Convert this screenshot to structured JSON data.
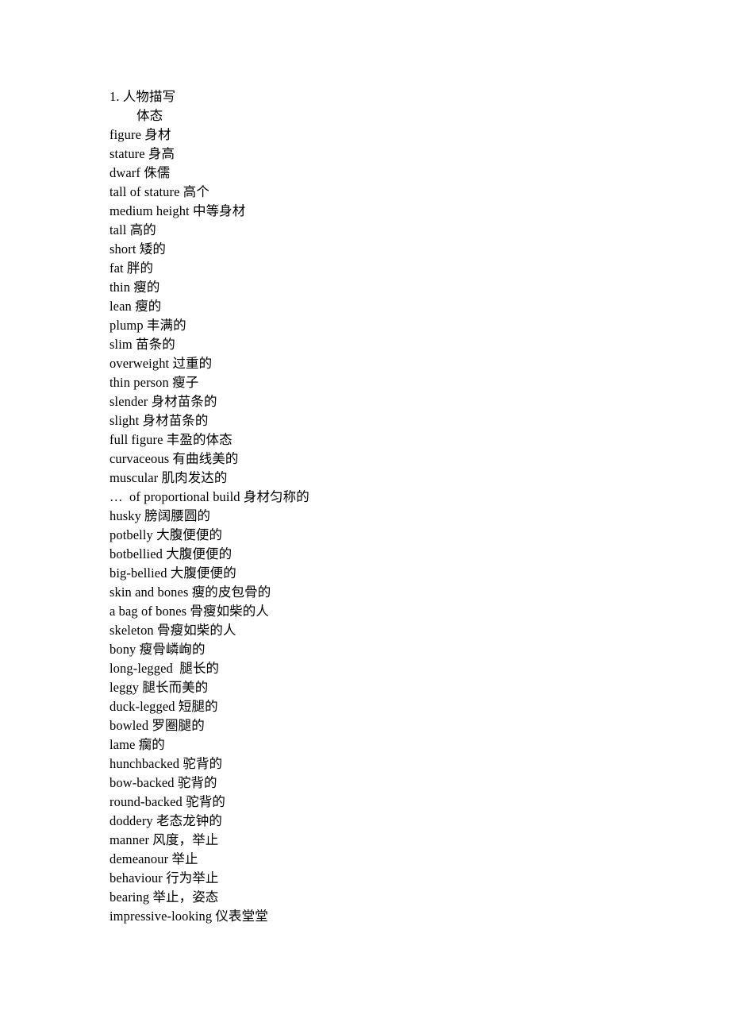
{
  "document": {
    "section_number": "1.",
    "section_title": "人物描写",
    "subsection_title": "体态",
    "heading_line": "1. 人物描写",
    "entries": [
      "figure 身材",
      "stature 身高",
      "dwarf 侏儒",
      "tall of stature 高个",
      "medium height 中等身材",
      "tall 高的",
      "short 矮的",
      "fat 胖的",
      "thin 瘦的",
      "lean 瘦的",
      "plump 丰满的",
      "slim 苗条的",
      "overweight 过重的",
      "thin person 瘦子",
      "slender 身材苗条的",
      "slight 身材苗条的",
      "full figure 丰盈的体态",
      "curvaceous 有曲线美的",
      "muscular 肌肉发达的",
      "…  of proportional build 身材匀称的",
      "husky 膀阔腰圆的",
      "potbelly 大腹便便的",
      "botbellied 大腹便便的",
      "big-bellied 大腹便便的",
      "skin and bones 瘦的皮包骨的",
      "a bag of bones 骨瘦如柴的人",
      "skeleton 骨瘦如柴的人",
      "bony 瘦骨嶙峋的",
      "long-legged  腿长的",
      "leggy 腿长而美的",
      "duck-legged 短腿的",
      "bowled 罗圈腿的",
      "lame 瘸的",
      "hunchbacked 驼背的",
      "bow-backed 驼背的",
      "round-backed 驼背的",
      "doddery 老态龙钟的",
      "manner 风度，举止",
      "demeanour 举止",
      "behaviour 行为举止",
      "bearing 举止，姿态",
      "impressive-looking 仪表堂堂"
    ]
  },
  "colors": {
    "text": "#000000",
    "background": "#ffffff"
  }
}
